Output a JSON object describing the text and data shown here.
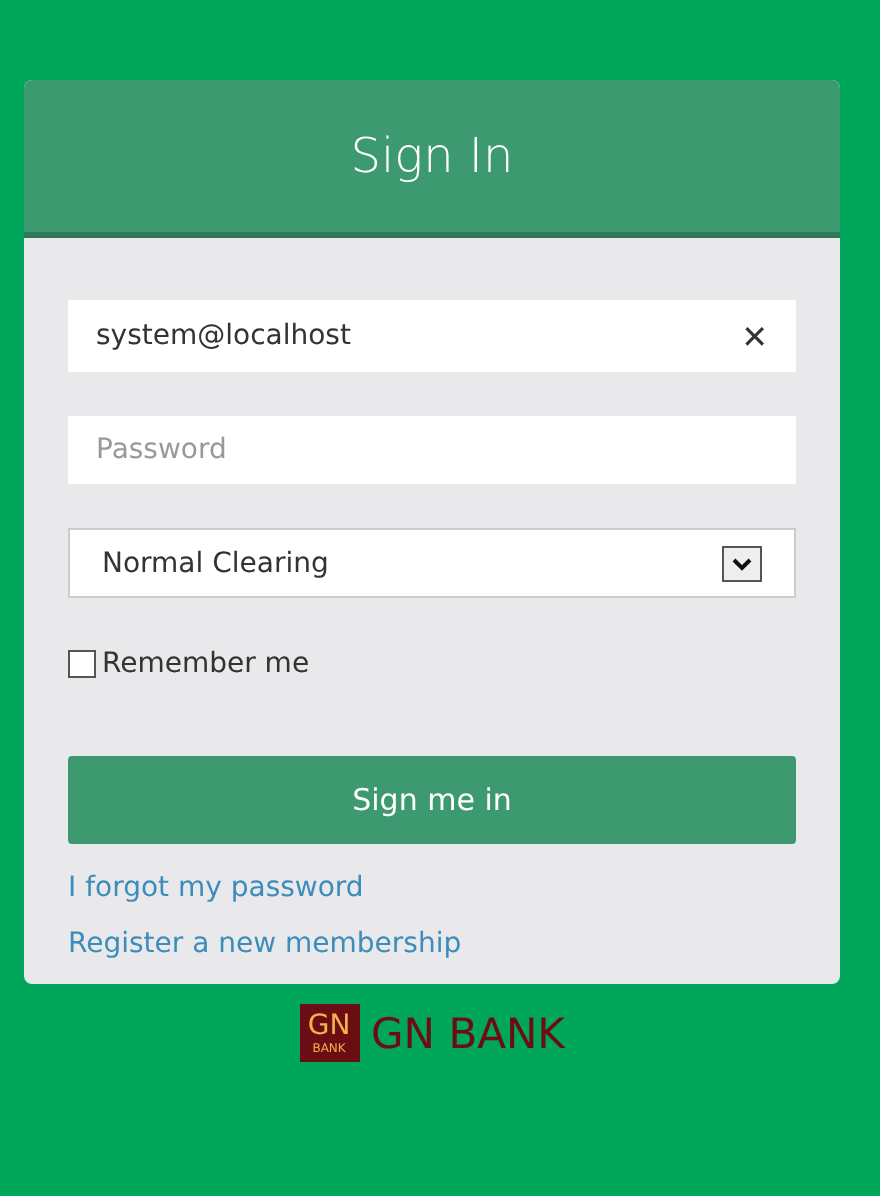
{
  "header": {
    "title": "Sign In"
  },
  "email": {
    "value": "system@localhost",
    "clear": "✕"
  },
  "password": {
    "placeholder": "Password"
  },
  "clearing": {
    "value": "Normal Clearing"
  },
  "remember": {
    "label": "Remember me",
    "checked": false
  },
  "submit": "Sign me in",
  "links": [
    "I forgot my password",
    "Register a new membership"
  ],
  "logo": {
    "mark": "GN",
    "mark_sub": "BANK",
    "name": "GN BANK"
  }
}
